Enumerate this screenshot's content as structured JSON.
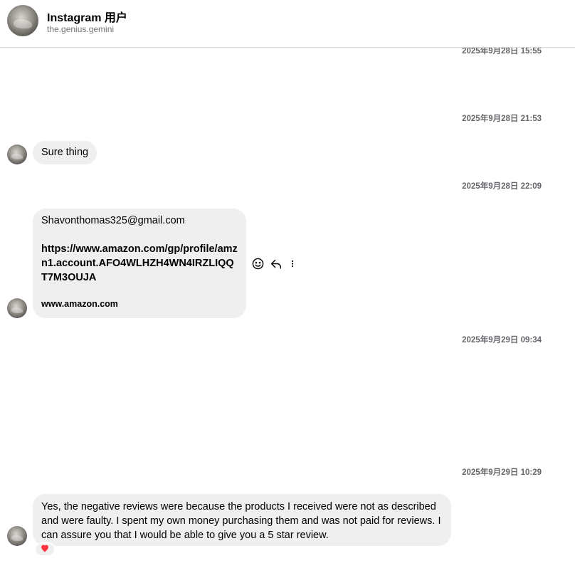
{
  "header": {
    "name": "Instagram 用户",
    "handle": "the.genius.gemini"
  },
  "timestamps": [
    "2025年9月28日 15:55",
    "2025年9月28日 21:53",
    "2025年9月28日 22:09",
    "2025年9月29日 09:34",
    "2025年9月29日 10:29"
  ],
  "messages": [
    {
      "text": "Sure thing"
    },
    {
      "email": "Shavonthomas325@gmail.com",
      "link": "https://www.amazon.com/gp/profile/amzn1.account.AFO4WLHZH4WN4IRZLIQQT7M3OUJA",
      "domain": "www.amazon.com"
    },
    {
      "text": "Yes, the negative reviews were because the products I received were not as described and were faulty. I spent my own money purchasing them and was not paid for reviews. I can assure you that I would be able to give you a 5 star review."
    }
  ],
  "icons": {
    "emoji": "smiley-icon",
    "reply": "reply-icon",
    "more": "more-options-icon",
    "reaction": "heart-icon"
  },
  "colors": {
    "bubble": "#efefef",
    "timestamp": "#65676b",
    "heart": "#ff3040"
  }
}
